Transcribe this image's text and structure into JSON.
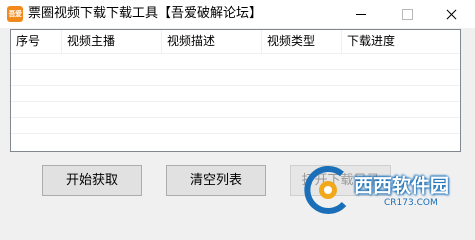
{
  "window": {
    "icon_text": "吾爱",
    "title": "票圈视频下载下载工具【吾爱破解论坛】"
  },
  "listview": {
    "columns": [
      "序号",
      "视频主播",
      "视频描述",
      "视频类型",
      "下载进度"
    ],
    "rows": []
  },
  "buttons": {
    "start": "开始获取",
    "clear": "清空列表",
    "open": "打开下载目录"
  },
  "watermark": {
    "brand": "西西软件园",
    "url": "CR173.COM"
  },
  "colors": {
    "titlebar": "#ffffff",
    "window_bg": "#f0f0f0",
    "icon_bg": "#f28a1b",
    "watermark_blue": "#1a6fb8"
  }
}
